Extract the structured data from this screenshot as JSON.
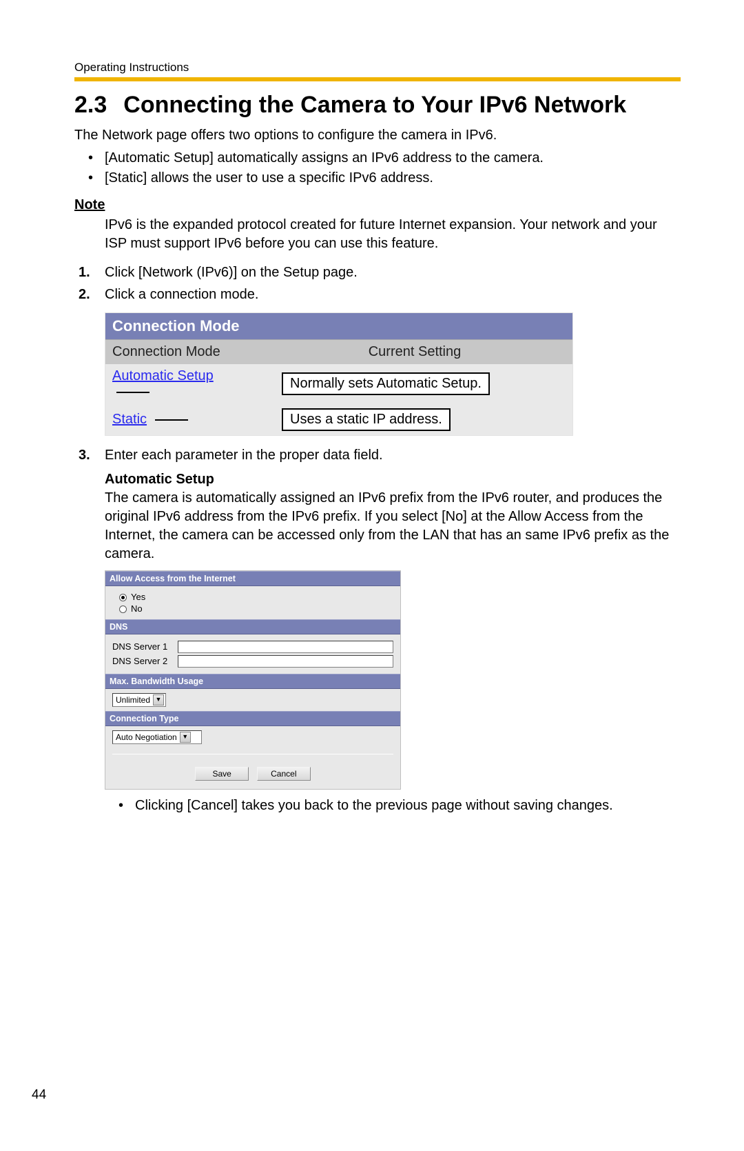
{
  "running_head": "Operating Instructions",
  "section_number": "2.3",
  "section_title": "Connecting the Camera to Your IPv6 Network",
  "intro": "The Network page offers two options to configure the camera in IPv6.",
  "bullets": [
    "[Automatic Setup] automatically assigns an IPv6 address to the camera.",
    "[Static] allows the user to use a specific IPv6 address."
  ],
  "note_label": "Note",
  "note_body": "IPv6 is the expanded protocol created for future Internet expansion. Your network and your ISP must support IPv6 before you can use this feature.",
  "steps": [
    "Click [Network (IPv6)] on the Setup page.",
    "Click a connection mode.",
    "Enter each parameter in the proper data field."
  ],
  "fig1": {
    "title": "Connection Mode",
    "col_left": "Connection Mode",
    "col_right": "Current Setting",
    "rows": [
      {
        "link": "Automatic Setup",
        "callout": "Normally sets Automatic Setup."
      },
      {
        "link": "Static",
        "callout": "Uses a static IP address."
      }
    ]
  },
  "auto_setup": {
    "heading": "Automatic Setup",
    "text": "The camera is automatically assigned an IPv6 prefix from the IPv6 router, and produces the original IPv6 address from the IPv6 prefix. If you select [No] at the Allow Access from the Internet, the camera can be accessed only from the LAN that has an same IPv6 prefix as the camera."
  },
  "fig2": {
    "section_allow": "Allow Access from the Internet",
    "opt_yes": "Yes",
    "opt_no": "No",
    "section_dns": "DNS",
    "dns1_label": "DNS Server 1",
    "dns2_label": "DNS Server 2",
    "section_bw": "Max. Bandwidth Usage",
    "bw_value": "Unlimited",
    "section_ct": "Connection Type",
    "ct_value": "Auto Negotiation",
    "btn_save": "Save",
    "btn_cancel": "Cancel"
  },
  "post_bullet": "Clicking [Cancel] takes you back to the previous page without saving changes.",
  "page_number": "44"
}
